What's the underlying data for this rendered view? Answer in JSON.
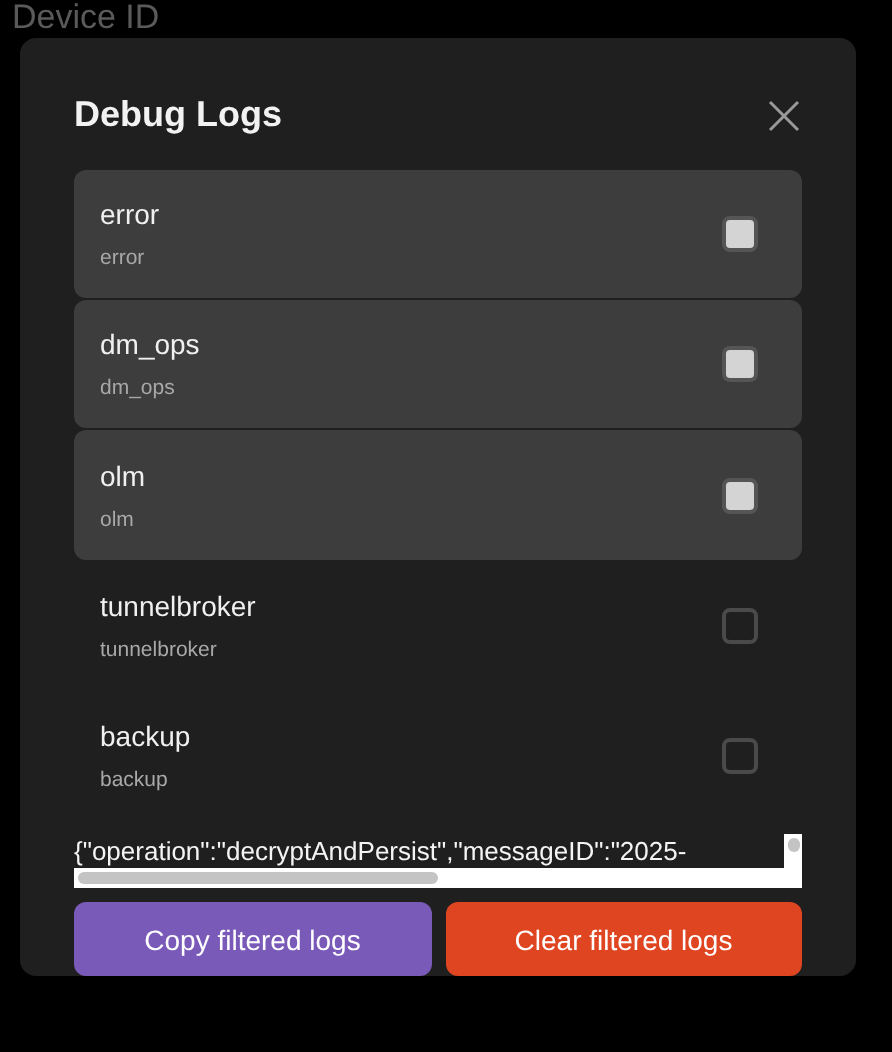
{
  "background": {
    "label": "Device ID"
  },
  "dialog": {
    "title": "Debug Logs",
    "filters": [
      {
        "name": "error",
        "tag": "error",
        "checked": true
      },
      {
        "name": "dm_ops",
        "tag": "dm_ops",
        "checked": true
      },
      {
        "name": "olm",
        "tag": "olm",
        "checked": true
      },
      {
        "name": "tunnelbroker",
        "tag": "tunnelbroker",
        "checked": false
      },
      {
        "name": "backup",
        "tag": "backup",
        "checked": false
      }
    ],
    "log_line": "{\"operation\":\"decryptAndPersist\",\"messageID\":\"2025-",
    "buttons": [
      {
        "label": "Copy filtered logs",
        "kind": "copy"
      },
      {
        "label": "Clear filtered logs",
        "kind": "clear"
      }
    ]
  }
}
